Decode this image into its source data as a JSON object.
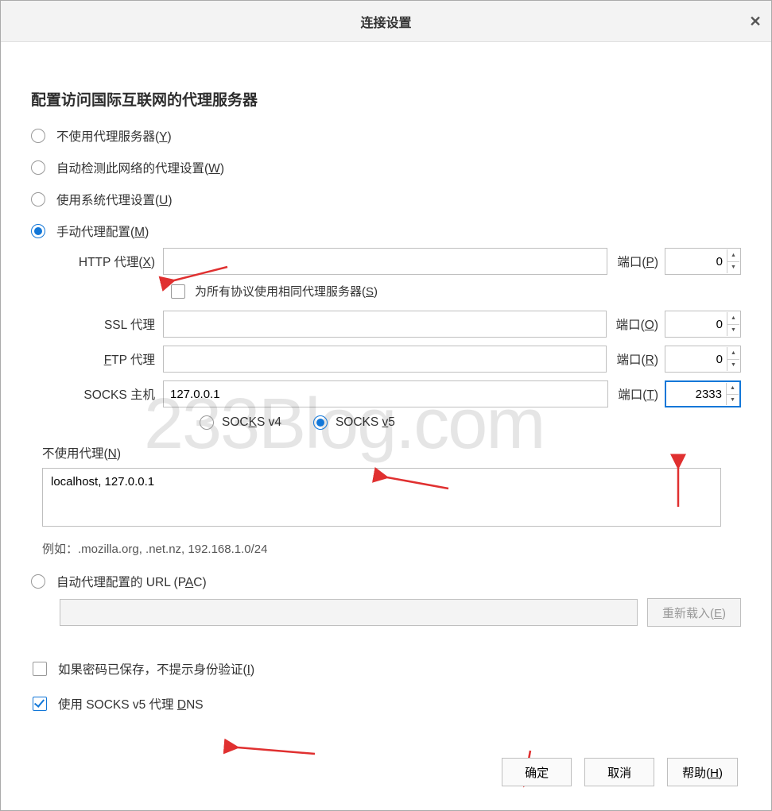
{
  "dialog": {
    "title": "连接设置",
    "heading": "配置访问国际互联网的代理服务器"
  },
  "proxy_mode": {
    "none": {
      "label_pre": "不使用代理服务器(",
      "key": "Y",
      "label_post": ")"
    },
    "auto_detect": {
      "label_pre": "自动检测此网络的代理设置(",
      "key": "W",
      "label_post": ")"
    },
    "system": {
      "label_pre": "使用系统代理设置(",
      "key": "U",
      "label_post": ")"
    },
    "manual": {
      "label_pre": "手动代理配置(",
      "key": "M",
      "label_post": ")"
    },
    "pac": {
      "label_pre": "自动代理配置的 URL  (P",
      "key": "A",
      "label_post": "C)"
    }
  },
  "manual": {
    "http_label_pre": "HTTP 代理(",
    "http_key": "X",
    "http_label_post": ")",
    "http_value": "",
    "http_port_label_pre": "端口(",
    "http_port_key": "P",
    "http_port_label_post": ")",
    "http_port": "0",
    "same_label_pre": "为所有协议使用相同代理服务器(",
    "same_key": "S",
    "same_label_post": ")",
    "ssl_label": "SSL 代理",
    "ssl_value": "",
    "ssl_port_label_pre": "端口(",
    "ssl_port_key": "O",
    "ssl_port_label_post": ")",
    "ssl_port": "0",
    "ftp_label_pre": "",
    "ftp_key": "F",
    "ftp_label_post": "TP 代理",
    "ftp_value": "",
    "ftp_port_label_pre": "端口(",
    "ftp_port_key": "R",
    "ftp_port_label_post": ")",
    "ftp_port": "0",
    "socks_label": "SOCKS 主机",
    "socks_value": "127.0.0.1",
    "socks_port_label_pre": "端口(",
    "socks_port_key": "T",
    "socks_port_label_post": ")",
    "socks_port": "2333",
    "socks_v4_pre": "SOC",
    "socks_v4_key": "K",
    "socks_v4_post": "S v4",
    "socks_v5_pre": "SOCKS ",
    "socks_v5_key": "v",
    "socks_v5_post": "5"
  },
  "noproxy": {
    "label_pre": "不使用代理(",
    "label_key": "N",
    "label_post": ")",
    "value": "localhost, 127.0.0.1",
    "example": "例如：.mozilla.org, .net.nz, 192.168.1.0/24"
  },
  "pac": {
    "url": "",
    "reload_pre": "重新载入(",
    "reload_key": "E",
    "reload_post": ")"
  },
  "checks": {
    "no_prompt_pre": "如果密码已保存，不提示身份验证(",
    "no_prompt_key": "I",
    "no_prompt_post": ")",
    "dns_pre": "使用 SOCKS v5 代理 ",
    "dns_key": "D",
    "dns_post": "NS"
  },
  "buttons": {
    "ok": "确定",
    "cancel": "取消",
    "help_pre": "帮助(",
    "help_key": "H",
    "help_post": ")"
  },
  "watermark": "233Blog.com"
}
